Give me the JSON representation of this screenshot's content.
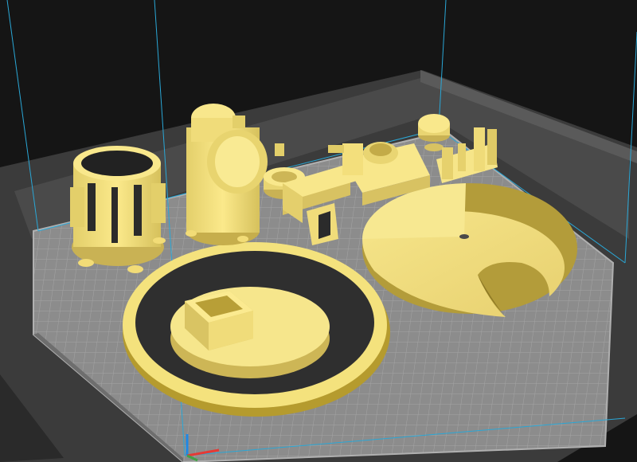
{
  "viewport": {
    "background_color": "#151515",
    "bed_color": "#8f8f8f",
    "bed_grid_color": "#9c9c9c",
    "build_volume_line_color": "#2aa7d6",
    "model_color": "#f3e27e",
    "model_shadow_color": "#b59b2e"
  },
  "axes": {
    "x_axis_color": "#e53935",
    "y_axis_color": "#43a047",
    "z_axis_color": "#1e88e5"
  },
  "models": [
    "cylindrical-cage-part",
    "tall-tube-part",
    "small-cup-part",
    "rectangular-bracket-part",
    "gear-mount-part",
    "small-knob-part",
    "fork-bracket-part",
    "large-cam-disc-part",
    "round-base-plate-part",
    "square-socket-part"
  ]
}
